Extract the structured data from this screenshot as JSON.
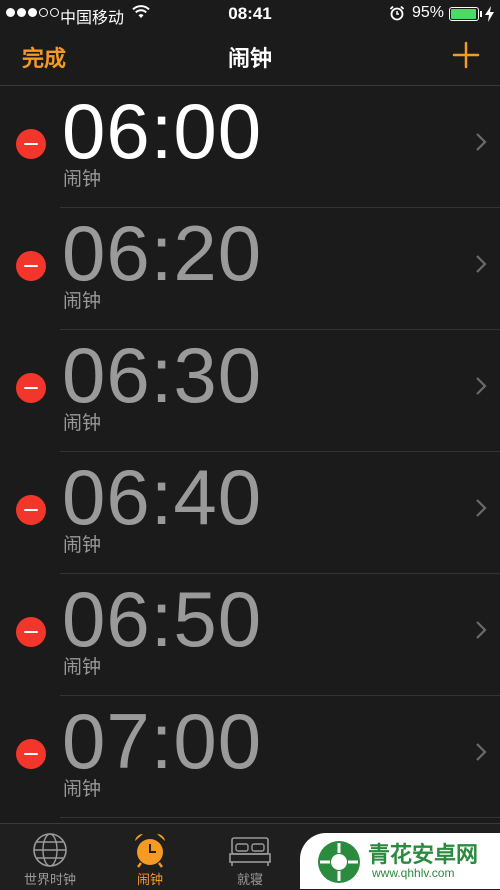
{
  "status_bar": {
    "carrier": "中国移动",
    "time": "08:41",
    "battery_percent": "95%",
    "battery_level": 0.95
  },
  "nav": {
    "done_label": "完成",
    "title": "闹钟"
  },
  "alarms": [
    {
      "time": "06:00",
      "label": "闹钟"
    },
    {
      "time": "06:20",
      "label": "闹钟"
    },
    {
      "time": "06:30",
      "label": "闹钟"
    },
    {
      "time": "06:40",
      "label": "闹钟"
    },
    {
      "time": "06:50",
      "label": "闹钟"
    },
    {
      "time": "07:00",
      "label": "闹钟"
    }
  ],
  "tabs": [
    {
      "label": "世界时钟",
      "icon": "globe-icon"
    },
    {
      "label": "闹钟",
      "icon": "alarm-clock-icon",
      "active": true
    },
    {
      "label": "就寝",
      "icon": "bed-icon"
    }
  ],
  "watermark": {
    "title": "青花安卓网",
    "url": "www.qhhlv.com"
  },
  "colors": {
    "accent": "#f59a23",
    "delete": "#f2362b",
    "battery": "#4cd964"
  }
}
